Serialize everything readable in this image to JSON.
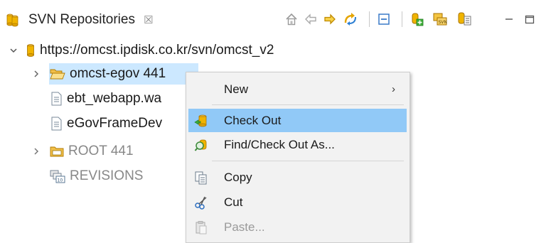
{
  "view": {
    "title": "SVN Repositories",
    "close_glyph": "☒",
    "toolbar": [
      {
        "name": "home-icon"
      },
      {
        "name": "back-arrow-icon"
      },
      {
        "name": "forward-arrow-icon"
      },
      {
        "name": "refresh-sync-icon"
      },
      {
        "name": "collapse-all-icon"
      },
      {
        "name": "new-repository-location-icon"
      },
      {
        "name": "svn-import-icon"
      },
      {
        "name": "show-properties-icon"
      },
      {
        "name": "minimize-icon"
      },
      {
        "name": "maximize-icon"
      }
    ]
  },
  "tree": {
    "repository": "https://omcst.ipdisk.co.kr/svn/omcst_v2",
    "items": [
      {
        "label": "omcst-egov 441",
        "kind": "folder-open",
        "expandable": true,
        "selected": true
      },
      {
        "label": "ebt_webapp.wa",
        "kind": "file",
        "expandable": false
      },
      {
        "label": "eGovFrameDev",
        "kind": "file",
        "expandable": false
      },
      {
        "label": "ROOT 441",
        "kind": "folder",
        "expandable": true,
        "dimmed": true
      },
      {
        "label": "REVISIONS",
        "kind": "revisions",
        "expandable": false,
        "dimmed": true
      }
    ]
  },
  "context_menu": {
    "items": [
      {
        "label": "New",
        "submenu_arrow": "›",
        "icon": ""
      },
      {
        "label": "Check Out",
        "icon": "checkout-icon",
        "highlighted": true
      },
      {
        "label": "Find/Check Out As...",
        "icon": "find-checkout-icon"
      },
      {
        "label": "Copy",
        "icon": "copy-icon"
      },
      {
        "label": "Cut",
        "icon": "scissors-icon"
      },
      {
        "label": "Paste...",
        "icon": "paste-icon",
        "disabled": true
      }
    ]
  },
  "colors": {
    "selection": "#cce8ff",
    "menu_highlight": "#91c9f7",
    "menu_background": "#f2f2f2",
    "repo_icon": "#f0b400",
    "folder_icon": "#e8a800"
  }
}
